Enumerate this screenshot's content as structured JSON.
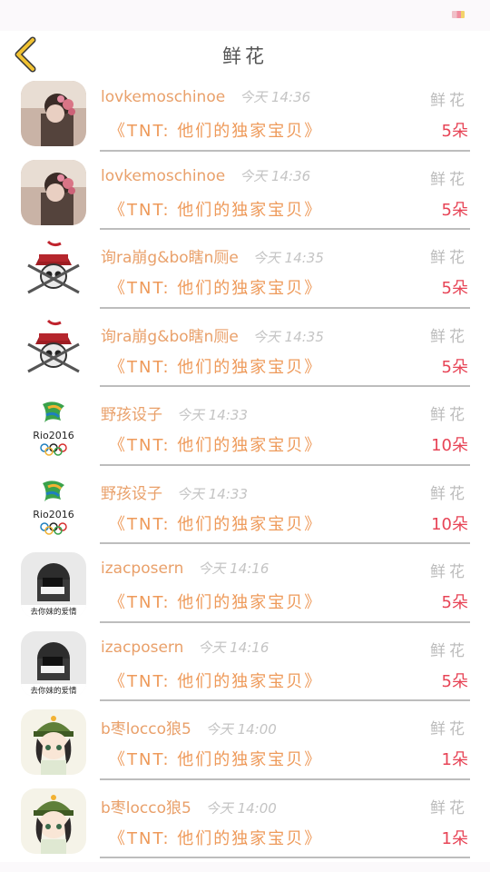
{
  "nav": {
    "title": "鲜花",
    "back_icon": "chevron-left-icon",
    "accent": "#f1c232"
  },
  "items": [
    {
      "user": "lovkemoschinoe",
      "time": "今天 14:36",
      "gift_type": "鲜花",
      "gift_name": "《TNT:  他们的独家宝贝》",
      "count": "5朵",
      "avatar": "girl-flowers"
    },
    {
      "user": "lovkemoschinoe",
      "time": "今天 14:36",
      "gift_type": "鲜花",
      "gift_name": "《TNT:  他们的独家宝贝》",
      "count": "5朵",
      "avatar": "girl-flowers"
    },
    {
      "user": "询ra崩g&bo瞎n厕e",
      "time": "今天 14:35",
      "gift_type": "鲜花",
      "gift_name": "《TNT:  他们的独家宝贝》",
      "count": "5朵",
      "avatar": "pirate-skull"
    },
    {
      "user": "询ra崩g&bo瞎n厕e",
      "time": "今天 14:35",
      "gift_type": "鲜花",
      "gift_name": "《TNT:  他们的独家宝贝》",
      "count": "5朵",
      "avatar": "pirate-skull"
    },
    {
      "user": "野孩设子",
      "time": "今天 14:33",
      "gift_type": "鲜花",
      "gift_name": "《TNT:  他们的独家宝贝》",
      "count": "10朵",
      "avatar": "rio2016",
      "avatar_text": "Rio2016"
    },
    {
      "user": "野孩设子",
      "time": "今天 14:33",
      "gift_type": "鲜花",
      "gift_name": "《TNT:  他们的独家宝贝》",
      "count": "10朵",
      "avatar": "rio2016",
      "avatar_text": "Rio2016"
    },
    {
      "user": "izacposern",
      "time": "今天 14:16",
      "gift_type": "鲜花",
      "gift_name": "《TNT:  他们的独家宝贝》",
      "count": "5朵",
      "avatar": "masked-girl",
      "avatar_text": "去你妹的爱情"
    },
    {
      "user": "izacposern",
      "time": "今天 14:16",
      "gift_type": "鲜花",
      "gift_name": "《TNT:  他们的独家宝贝》",
      "count": "5朵",
      "avatar": "masked-girl",
      "avatar_text": "去你妹的爱情"
    },
    {
      "user": "b枣locco狼5",
      "time": "今天 14:00",
      "gift_type": "鲜花",
      "gift_name": "《TNT:  他们的独家宝贝》",
      "count": "1朵",
      "avatar": "anime-girl"
    },
    {
      "user": "b枣locco狼5",
      "time": "今天 14:00",
      "gift_type": "鲜花",
      "gift_name": "《TNT:  他们的独家宝贝》",
      "count": "1朵",
      "avatar": "anime-girl"
    }
  ]
}
